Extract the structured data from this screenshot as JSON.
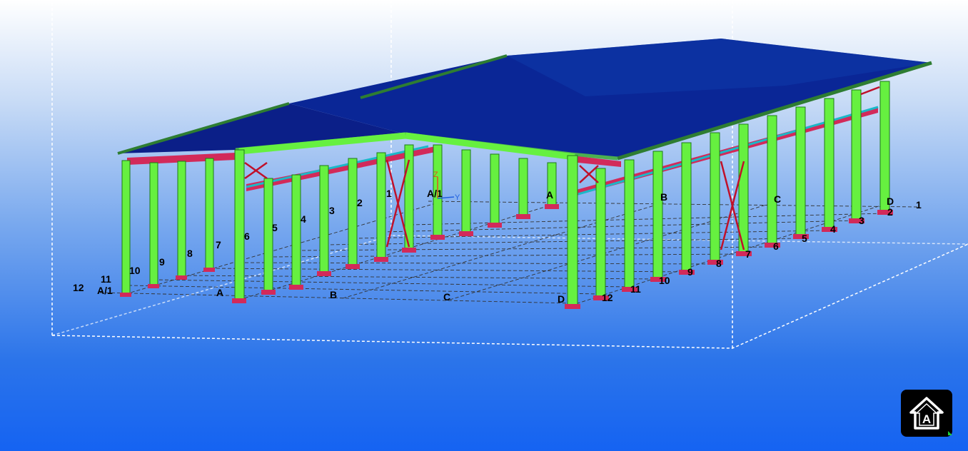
{
  "viewer": {
    "colors": {
      "roof": "#0a1f8c",
      "roof_edge": "#2e7d32",
      "column": "#66f040",
      "column_edge": "#1d7a18",
      "beam": "#d22a5a",
      "bracing": "#c0102a",
      "grid_line": "#3a3a3a",
      "bounding_box": "#ffffff"
    },
    "gridlines": {
      "near_numbers": [
        "12",
        "11",
        "10",
        "9",
        "8",
        "7",
        "6",
        "5",
        "4",
        "3",
        "2",
        "1"
      ],
      "near_letters": [
        "A/1",
        "A",
        "B",
        "C",
        "D"
      ],
      "far_letters": [
        "A/1",
        "A",
        "B",
        "C",
        "D"
      ],
      "right_numbers": [
        "1",
        "2",
        "3",
        "4",
        "5",
        "6",
        "7",
        "8",
        "9",
        "10",
        "11",
        "12"
      ]
    },
    "axis_triad": {
      "z": "Z",
      "y": "Y"
    }
  },
  "logo": {
    "icon": "house-a-logo-icon",
    "letter": "A"
  }
}
